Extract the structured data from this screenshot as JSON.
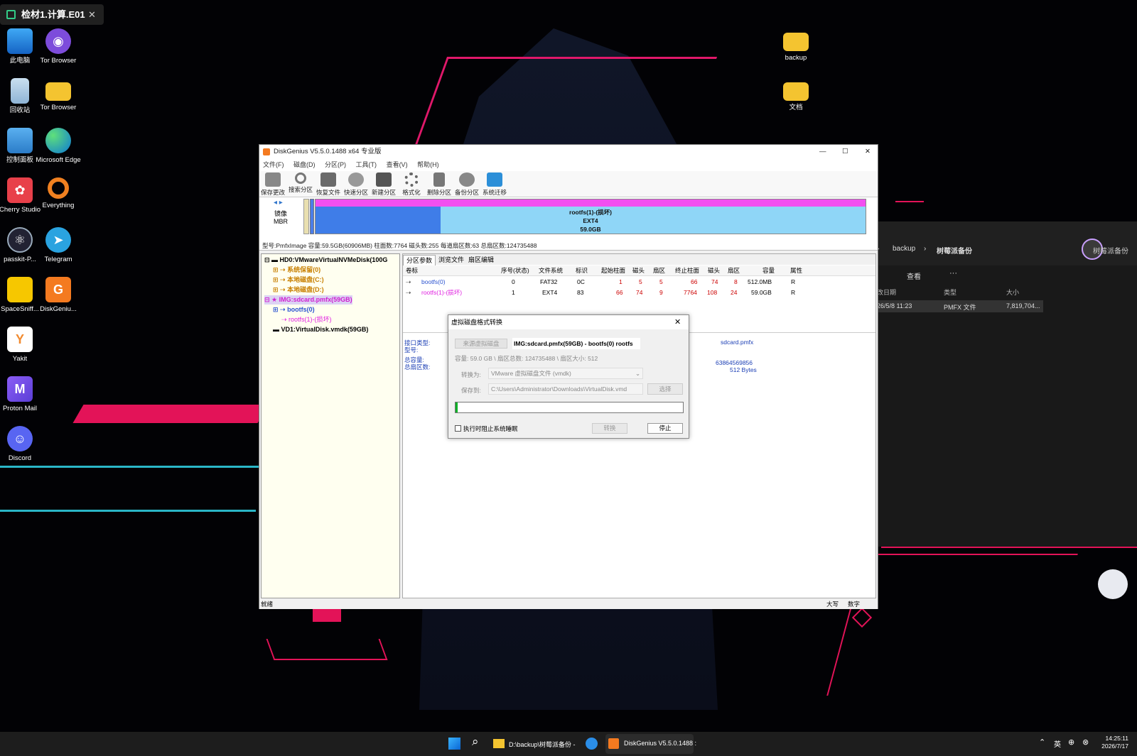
{
  "tab": {
    "title": "检材1.计算.E01",
    "close": "✕"
  },
  "desktop_icons": [
    {
      "label": "此电脑"
    },
    {
      "label": "Tor Browser"
    },
    {
      "label": "回收站"
    },
    {
      "label": "Tor Browser"
    },
    {
      "label": "控制面板"
    },
    {
      "label": "Microsoft Edge"
    },
    {
      "label": "Cherry Studio"
    },
    {
      "label": "Everything"
    },
    {
      "label": "passkit-P..."
    },
    {
      "label": "Telegram"
    },
    {
      "label": "SpaceSniff..."
    },
    {
      "label": "DiskGeniu..."
    },
    {
      "label": "Yakit"
    },
    {
      "label": "Proton Mail"
    },
    {
      "label": "Discord"
    },
    {
      "label": "backup"
    },
    {
      "label": "文档"
    }
  ],
  "explorer": {
    "crumb1": "backup",
    "crumb2": "树莓派备份",
    "search_hint": "树莓派备份",
    "view_btn": "查看",
    "more_btn": "···",
    "col_date": "改日期",
    "col_type": "类型",
    "col_size": "大小",
    "row_date": "26/5/8 11:23",
    "row_type": "PMFX 文件",
    "row_size": "7,819,704..."
  },
  "window": {
    "title": "DiskGenius V5.5.0.1488 x64 专业版",
    "menu": [
      "文件(F)",
      "磁盘(D)",
      "分区(P)",
      "工具(T)",
      "查看(V)",
      "帮助(H)"
    ],
    "toolbar": [
      "保存更改",
      "搜索分区",
      "恢复文件",
      "快速分区",
      "新建分区",
      "格式化",
      "删除分区",
      "备份分区",
      "系统迁移"
    ],
    "map_left_top": "镜像",
    "map_left_bottom": "MBR",
    "map_part_name": "rootfs(1)-(损坏)",
    "map_part_fs": "EXT4",
    "map_part_size": "59.0GB",
    "diskinfo": "型号:PmfxImage  容量:59.5GB(60906MB)  柱面数:7764  磁头数:255  每道扇区数:63  总扇区数:124735488",
    "tree": [
      "HD0:VMwareVirtualNVMeDisk(100G",
      "系统保留(0)",
      "本地磁盘(C:)",
      "本地磁盘(D:)",
      "IMG:sdcard.pmfx(59GB)",
      "bootfs(0)",
      "rootfs(1)-(损坏)",
      "VD1:VirtualDisk.vmdk(59GB)"
    ],
    "tabs": [
      "分区参数",
      "浏览文件",
      "扇区编辑"
    ],
    "columns": [
      "卷标",
      "序号(状态)",
      "文件系统",
      "标识",
      "起始柱面",
      "磁头",
      "扇区",
      "终止柱面",
      "磁头",
      "扇区",
      "容量",
      "属性"
    ],
    "rows": [
      [
        "bootfs(0)",
        "0",
        "FAT32",
        "0C",
        "1",
        "5",
        "5",
        "66",
        "74",
        "8",
        "512.0MB",
        "R"
      ],
      [
        "rootfs(1)-(损坏)",
        "1",
        "EXT4",
        "83",
        "66",
        "74",
        "9",
        "7764",
        "108",
        "24",
        "59.0GB",
        "R"
      ]
    ],
    "info_labels": [
      "接口类型:",
      "型号:",
      "总容量:",
      "总扇区数:"
    ],
    "info_values": [
      "sdcard.pmfx",
      "63864569856",
      "512 Bytes"
    ],
    "status_left": "就绪",
    "status_caps": "大写",
    "status_num": "数字"
  },
  "dialog": {
    "title": "虚拟磁盘格式转换",
    "source_btn": "来源虚拟磁盘",
    "source_val": "IMG:sdcard.pmfx(59GB) - bootfs(0) rootfs",
    "capacity": "容量: 59.0 GB \\ 扇区总数: 124735488 \\ 扇区大小: 512",
    "convert_label": "转换为:",
    "convert_val": "VMware 虚拟磁盘文件 (vmdk)",
    "save_label": "保存到:",
    "save_val": "C:\\Users\\Administrator\\Downloads\\VirtualDisk.vmd",
    "choose_btn": "选择",
    "progress": 0.01,
    "checkbox": "执行时阻止系统睡眠",
    "convert_btn": "转换",
    "stop_btn": "停止"
  },
  "taskbar": {
    "explorer_item": "D:\\backup\\树莓派备份 -",
    "dg_item": "DiskGenius V5.5.0.1488 :",
    "ime": "英",
    "time": "14:25:11",
    "date": "2026/7/17"
  }
}
